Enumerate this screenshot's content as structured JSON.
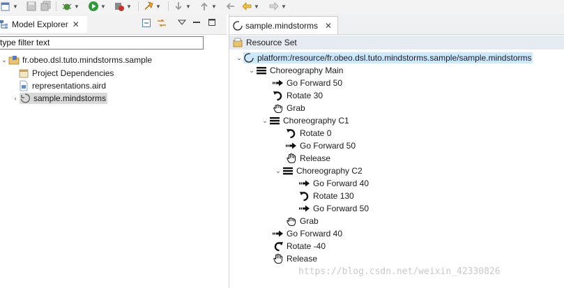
{
  "toolbar": {
    "icons": [
      "new-icon",
      "save-icon",
      "save-all-icon",
      "debug-icon",
      "run-icon",
      "run-external-icon",
      "pin-icon",
      "next-annotation-icon",
      "prev-annotation-icon",
      "last-edit-icon",
      "back-icon",
      "forward-icon"
    ]
  },
  "model_explorer": {
    "title": "Model Explorer",
    "close": "✕",
    "filter_value": "type filter text",
    "tree": [
      {
        "label": "fr.obeo.dsl.tuto.mindstorms.sample",
        "icon": "project-icon",
        "expanded": true
      },
      {
        "label": "Project Dependencies",
        "icon": "dependencies-icon"
      },
      {
        "label": "representations.aird",
        "icon": "aird-file-icon"
      },
      {
        "label": "sample.mindstorms",
        "icon": "mindstorms-file-icon",
        "selected": true
      }
    ]
  },
  "editor": {
    "tab_label": "sample.mindstorms",
    "tab_close": "✕",
    "header": "Resource Set",
    "root": "platform:/resource/fr.obeo.dsl.tuto.mindstorms.sample/sample.mindstorms",
    "tree": [
      {
        "label": "Choreography Main",
        "icon": "choreography-icon"
      },
      {
        "label": "Go Forward 50",
        "icon": "forward-icon"
      },
      {
        "label": "Rotate 30",
        "icon": "rotate-icon"
      },
      {
        "label": "Grab",
        "icon": "grab-icon"
      },
      {
        "label": "Choreography C1",
        "icon": "choreography-icon"
      },
      {
        "label": "Rotate 0",
        "icon": "rotate-icon"
      },
      {
        "label": "Go Forward 50",
        "icon": "forward-icon"
      },
      {
        "label": "Release",
        "icon": "release-icon"
      },
      {
        "label": "Choreography C2",
        "icon": "choreography-icon"
      },
      {
        "label": "Go Forward 40",
        "icon": "forward-icon"
      },
      {
        "label": "Rotate 130",
        "icon": "rotate-icon"
      },
      {
        "label": "Go Forward 50",
        "icon": "forward-icon"
      },
      {
        "label": "Grab",
        "icon": "grab-icon"
      },
      {
        "label": "Go Forward 40",
        "icon": "forward-icon"
      },
      {
        "label": "Rotate -40",
        "icon": "rotate-ccw-icon"
      },
      {
        "label": "Release",
        "icon": "release-icon"
      }
    ]
  },
  "watermark": "https://blog.csdn.net/weixin_42330826"
}
